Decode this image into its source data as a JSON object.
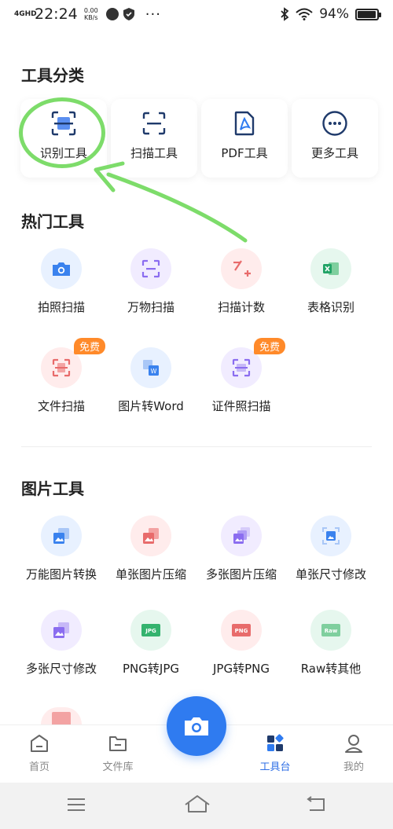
{
  "status_bar": {
    "signal": "4GHD",
    "time": "22:24",
    "speed": "0.00",
    "speed_unit": "KB/s",
    "more": "···",
    "battery_percent": "94%",
    "battery_level": 0.94
  },
  "categories": {
    "title": "工具分类",
    "items": [
      {
        "label": "识别工具",
        "icon": "scan-doc-icon"
      },
      {
        "label": "扫描工具",
        "icon": "scan-frame-icon"
      },
      {
        "label": "PDF工具",
        "icon": "pdf-icon"
      },
      {
        "label": "更多工具",
        "icon": "more-icon"
      }
    ]
  },
  "hot_tools": {
    "title": "热门工具",
    "items": [
      {
        "label": "拍照扫描",
        "icon": "camera-icon"
      },
      {
        "label": "万物扫描",
        "icon": "scan-frame-icon"
      },
      {
        "label": "扫描计数",
        "icon": "count-icon"
      },
      {
        "label": "表格识别",
        "icon": "excel-icon"
      },
      {
        "label": "文件扫描",
        "icon": "file-scan-icon",
        "badge": "免费"
      },
      {
        "label": "图片转Word",
        "icon": "word-icon"
      },
      {
        "label": "证件照扫描",
        "icon": "id-scan-icon",
        "badge": "免费"
      }
    ]
  },
  "image_tools": {
    "title": "图片工具",
    "items": [
      {
        "label": "万能图片转换",
        "icon": "image-convert-icon"
      },
      {
        "label": "单张图片压缩",
        "icon": "image-compress-icon"
      },
      {
        "label": "多张图片压缩",
        "icon": "images-compress-icon"
      },
      {
        "label": "单张尺寸修改",
        "icon": "image-resize-icon"
      },
      {
        "label": "多张尺寸修改",
        "icon": "images-resize-icon"
      },
      {
        "label": "PNG转JPG",
        "icon": "jpg-icon",
        "tag": "JPG"
      },
      {
        "label": "JPG转PNG",
        "icon": "png-icon",
        "tag": "PNG"
      },
      {
        "label": "Raw转其他",
        "icon": "raw-icon",
        "tag": "Raw"
      }
    ]
  },
  "bottom_nav": {
    "items": [
      {
        "label": "首页",
        "icon": "home-icon"
      },
      {
        "label": "文件库",
        "icon": "folder-icon"
      },
      {
        "label": "工具台",
        "icon": "toolbox-icon",
        "active": true
      },
      {
        "label": "我的",
        "icon": "profile-icon"
      }
    ]
  },
  "colors": {
    "accent": "#2f7bf0",
    "badge": "#ff8a2a",
    "annotation": "#7ddc6a"
  }
}
